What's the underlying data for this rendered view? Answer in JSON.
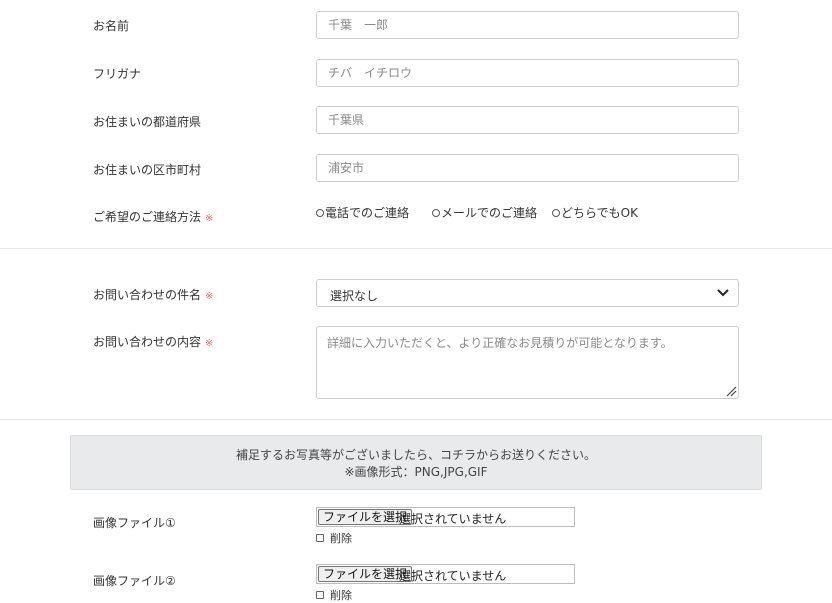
{
  "form": {
    "name": {
      "label": "お名前",
      "placeholder": "千葉　一郎"
    },
    "furigana": {
      "label": "フリガナ",
      "placeholder": "チバ　イチロウ"
    },
    "prefecture": {
      "label": "お住まいの都道府県",
      "placeholder": "千葉県"
    },
    "city": {
      "label": "お住まいの区市町村",
      "placeholder": "浦安市"
    },
    "contact_method": {
      "label": "ご希望のご連絡方法",
      "required_mark": "※",
      "options": [
        "電話でのご連絡",
        "メールでのご連絡",
        "どちらでもOK"
      ]
    },
    "subject": {
      "label": "お問い合わせの件名",
      "required_mark": "※",
      "selected": "選択なし"
    },
    "content": {
      "label": "お問い合わせの内容",
      "required_mark": "※",
      "placeholder": "詳細に入力いただくと、より正確なお見積りが可能となります。"
    }
  },
  "notice": {
    "line1": "補足するお写真等がございましたら、コチラからお送りください。",
    "line2": "※画像形式：PNG,JPG,GIF"
  },
  "files": [
    {
      "label": "画像ファイル①",
      "button": "ファイルを選択",
      "status": "選択されていません",
      "delete_label": "削除"
    },
    {
      "label": "画像ファイル②",
      "button": "ファイルを選択",
      "status": "選択されていません",
      "delete_label": "削除"
    }
  ]
}
